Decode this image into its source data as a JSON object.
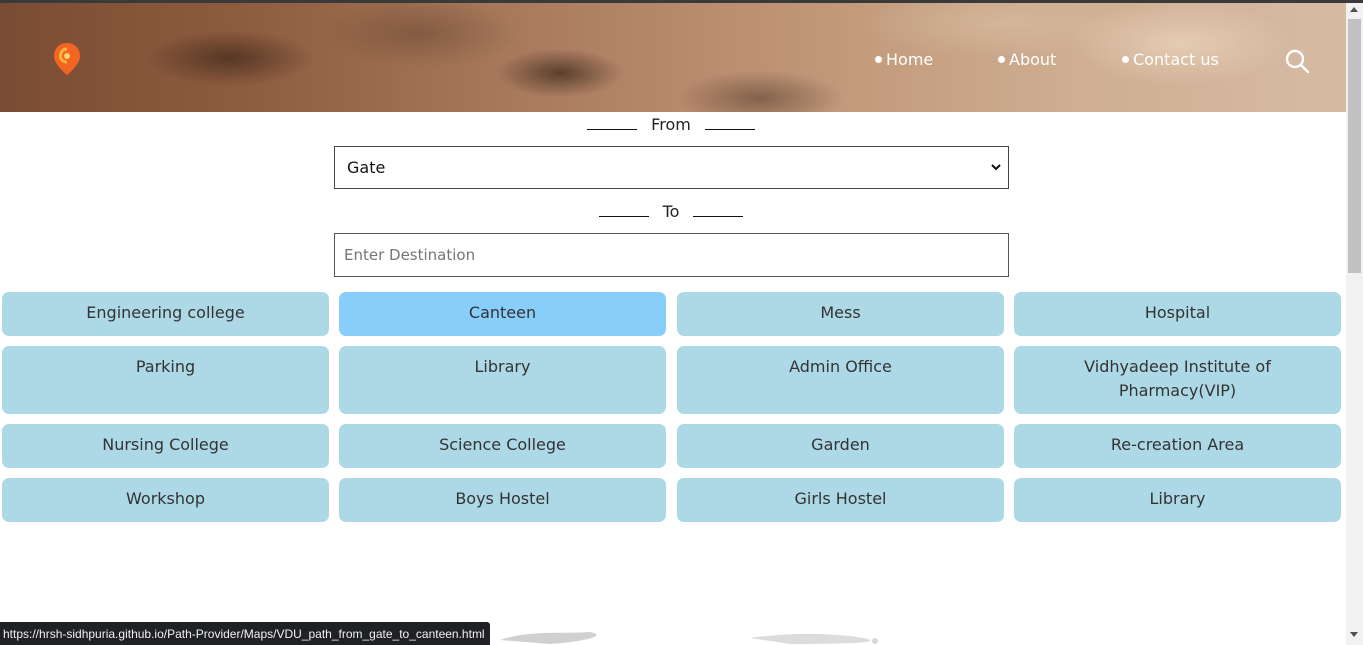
{
  "header": {
    "logo_icon": "map-pin-icon",
    "nav": [
      {
        "label": "Home"
      },
      {
        "label": "About"
      },
      {
        "label": "Contact us"
      }
    ],
    "search_icon": "search-icon"
  },
  "route": {
    "from_label": "From",
    "from_selected": "Gate",
    "to_label": "To",
    "to_placeholder": "Enter Destination",
    "to_value": ""
  },
  "destinations": [
    {
      "label": "Engineering college"
    },
    {
      "label": "Canteen"
    },
    {
      "label": "Mess"
    },
    {
      "label": "Hospital"
    },
    {
      "label": "Parking"
    },
    {
      "label": "Library"
    },
    {
      "label": "Admin Office"
    },
    {
      "label": "Vidhyadeep Institute of Pharmacy(VIP)"
    },
    {
      "label": "Nursing College"
    },
    {
      "label": "Science College"
    },
    {
      "label": "Garden"
    },
    {
      "label": "Re-creation Area"
    },
    {
      "label": "Workshop"
    },
    {
      "label": "Boys Hostel"
    },
    {
      "label": "Girls Hostel"
    },
    {
      "label": "Library"
    }
  ],
  "active_destination": "Canteen",
  "status_bar": {
    "url": "https://hrsh-sidhpuria.github.io/Path-Provider/Maps/VDU_path_from_gate_to_canteen.html"
  },
  "colors": {
    "tile": "#add8e6",
    "tile_active": "#87cefa",
    "logo_orange": "#f26522"
  }
}
